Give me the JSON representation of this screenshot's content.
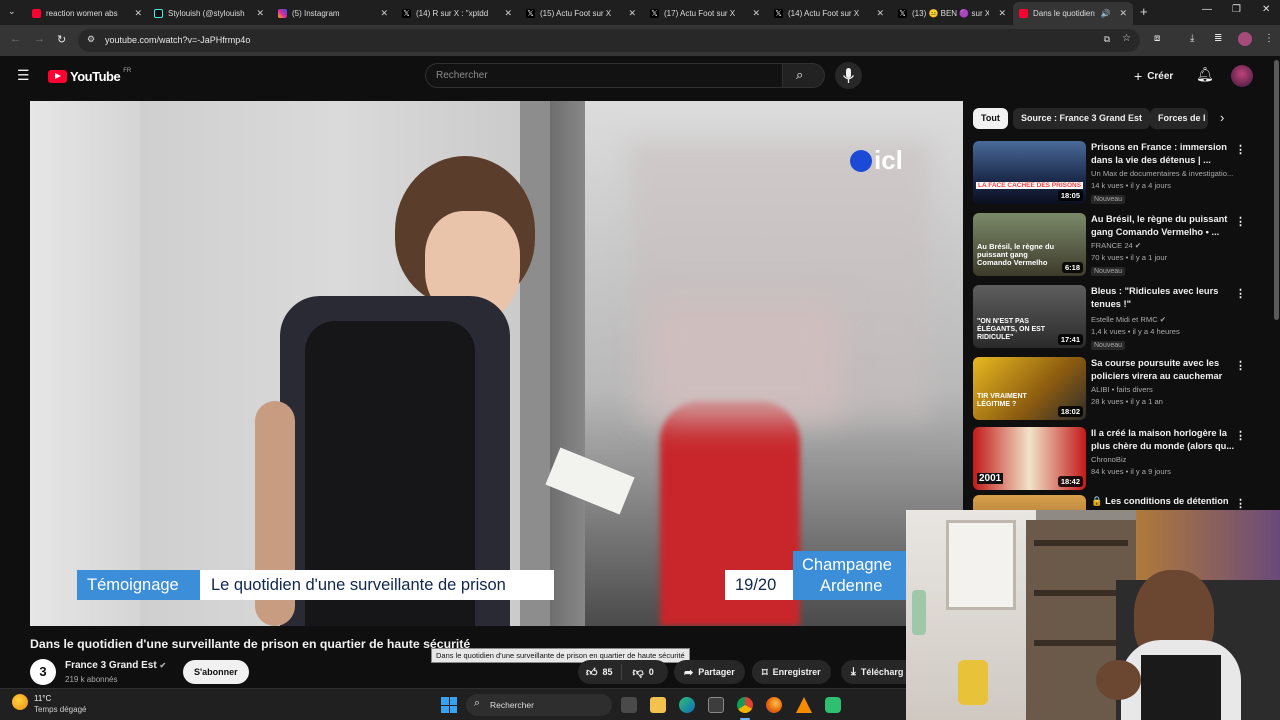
{
  "browser": {
    "tabs": [
      {
        "title": "reaction women abs",
        "color": "#ff0033"
      },
      {
        "title": "Stylouish (@stylouish",
        "color": "#111111"
      },
      {
        "title": "(5) Instagram",
        "color": "#d6249f"
      },
      {
        "title": "(14) R sur X : \"xptdd",
        "color": "#000000"
      },
      {
        "title": "(15) Actu Foot sur X",
        "color": "#000000"
      },
      {
        "title": "(17) Actu Foot sur X",
        "color": "#000000"
      },
      {
        "title": "(14) Actu Foot sur X",
        "color": "#000000"
      },
      {
        "title": "(13) 😐 BEN 🟣 sur X",
        "color": "#000000"
      },
      {
        "title": "Dans le quotidien",
        "color": "#ff0033"
      }
    ],
    "url": "youtube.com/watch?v=-JaPHfrmp4o"
  },
  "masthead": {
    "logo_text": "YouTube",
    "region": "FR",
    "search_placeholder": "Rechercher",
    "create_label": "Créer"
  },
  "video": {
    "watermark": "icl",
    "lower_third_tag": "Témoignage",
    "lower_third_text": "Le quotidien d'une surveillante de prison",
    "time_badge": "19/20",
    "region_badge_1": "Champagne",
    "region_badge_2": "Ardenne",
    "title": "Dans le quotidien d'une surveillante de prison en quartier de haute sécurité",
    "tooltip": "Dans le quotidien d'une surveillante de prison en quartier de haute sécurité"
  },
  "channel": {
    "avatar_text": "3",
    "name": "France 3 Grand Est",
    "subscribers": "219 k abonnés",
    "subscribe_label": "S'abonner"
  },
  "actions": {
    "likes": "85",
    "dislikes": "0",
    "share": "Partager",
    "save": "Enregistrer",
    "download": "Télécharg"
  },
  "chips": [
    "Tout",
    "Source : France 3 Grand Est",
    "Forces de l"
  ],
  "related": [
    {
      "title": "Prisons en France : immersion dans la vie des détenus | ...",
      "channel": "Un Max de documentaires & investigatio...",
      "meta": "14 k vues • il y a 4 jours",
      "badge": "Nouveau",
      "duration": "18:05",
      "thumb_text": "LA FACE CACHÉE DES PRISONS",
      "verified": false
    },
    {
      "title": "Au Brésil, le règne du puissant gang Comando Vermelho • ...",
      "channel": "FRANCE 24",
      "meta": "70 k vues • il y a 1 jour",
      "badge": "Nouveau",
      "duration": "6:18",
      "thumb_text": "Au Brésil, le règne du puissant gang Comando Vermelho",
      "verified": true
    },
    {
      "title": "Bleus : \"Ridicules avec leurs tenues !\"",
      "channel": "Estelle Midi et RMC",
      "meta": "1,4 k vues • il y a 4 heures",
      "badge": "Nouveau",
      "duration": "17:41",
      "thumb_text": "\"ON N'EST PAS ÉLÉGANTS, ON EST RIDICULE\"",
      "verified": true
    },
    {
      "title": "Sa course poursuite avec les policiers virera au cauchemar",
      "channel": "ALIBI  •  faits divers",
      "meta": "28 k vues • il y a 1 an",
      "badge": "",
      "duration": "18:02",
      "thumb_text": "TIR VRAIMENT LÉGITIME ?",
      "verified": false
    },
    {
      "title": "Il a créé la maison horlogère la plus chère du monde (alors qu...",
      "channel": "ChronoBiz",
      "meta": "84 k vues • il y a 9 jours",
      "badge": "",
      "duration": "18:42",
      "thumb_text": "2001",
      "verified": false
    },
    {
      "title": "🔒 Les conditions de détention",
      "channel": "",
      "meta": "",
      "badge": "",
      "duration": "",
      "thumb_text": "",
      "verified": false
    }
  ],
  "taskbar": {
    "weather_temp": "11°C",
    "weather_desc": "Temps dégagé",
    "search_placeholder": "Rechercher"
  }
}
